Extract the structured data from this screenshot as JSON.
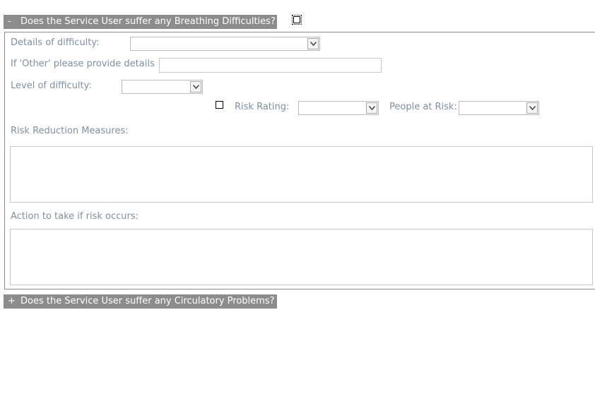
{
  "sections": [
    {
      "toggle": "-",
      "title": "Does the Service User suffer any Breathing Difficulties?",
      "expanded": true
    },
    {
      "toggle": "+",
      "title": "Does the Service User suffer any Circulatory Problems?",
      "expanded": false
    }
  ],
  "form": {
    "details_label": "Details of difficulty:",
    "details_value": "",
    "other_label": "If 'Other' please provide details",
    "other_value": "",
    "level_label": "Level of difficulty:",
    "level_value": "",
    "risk_rating_label": "Risk Rating:",
    "risk_rating_value": "",
    "people_at_risk_label": "People at Risk:",
    "people_at_risk_value": "",
    "risk_reduction_label": "Risk Reduction Measures:",
    "risk_reduction_value": "",
    "action_label": "Action to take if risk occurs:",
    "action_value": ""
  },
  "icons": {
    "dropdown": "chevron-down-icon",
    "toggle_collapse": "minus",
    "toggle_expand": "plus"
  }
}
